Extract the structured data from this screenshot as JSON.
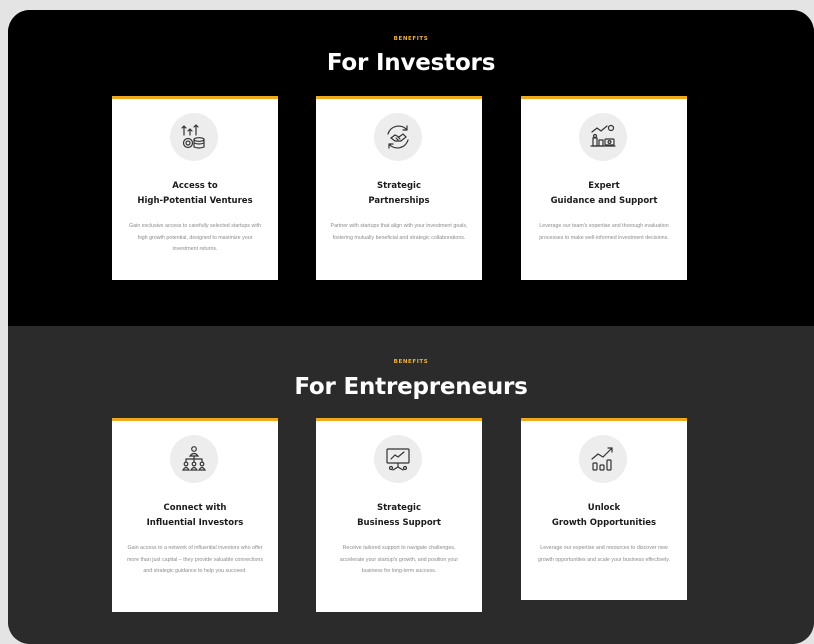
{
  "investors": {
    "eyebrow": "BENEFITS",
    "title": "For Investors",
    "cards": [
      {
        "icon": "growth-coins-icon",
        "title": "Access to\nHigh-Potential Ventures",
        "description": "Gain exclusive access to carefully selected startups with high growth potential, designed to maximize your investment returns."
      },
      {
        "icon": "handshake-cycle-icon",
        "title": "Strategic\nPartnerships",
        "description": "Partner with startups that align with your investment goals, fostering mutually beneficial and strategic collaborations."
      },
      {
        "icon": "money-analytics-icon",
        "title": "Expert\nGuidance and Support",
        "description": "Leverage our team's expertise and thorough evaluation processes to make well-informed investment decisions."
      }
    ]
  },
  "entrepreneurs": {
    "eyebrow": "BENEFITS",
    "title": "For Entrepreneurs",
    "cards": [
      {
        "icon": "network-people-icon",
        "title": "Connect with\nInfluential Investors",
        "description": "Gain access to a network of influential investors who offer more than just capital – they provide valuable connections and strategic guidance to help you succeed."
      },
      {
        "icon": "presentation-board-icon",
        "title": "Strategic\nBusiness Support",
        "description": "Receive tailored support to navigate challenges, accelerate your startup's growth, and position your business for long-term success."
      },
      {
        "icon": "growth-chart-icon",
        "title": "Unlock\nGrowth Opportunities",
        "description": "Leverage our expertise and resources to discover new growth opportunities and scale your business effectively."
      }
    ]
  },
  "colors": {
    "accent": "#f0a91b",
    "dark_section": "#000000",
    "gray_section": "#2b2b2b",
    "card": "#ffffff"
  }
}
